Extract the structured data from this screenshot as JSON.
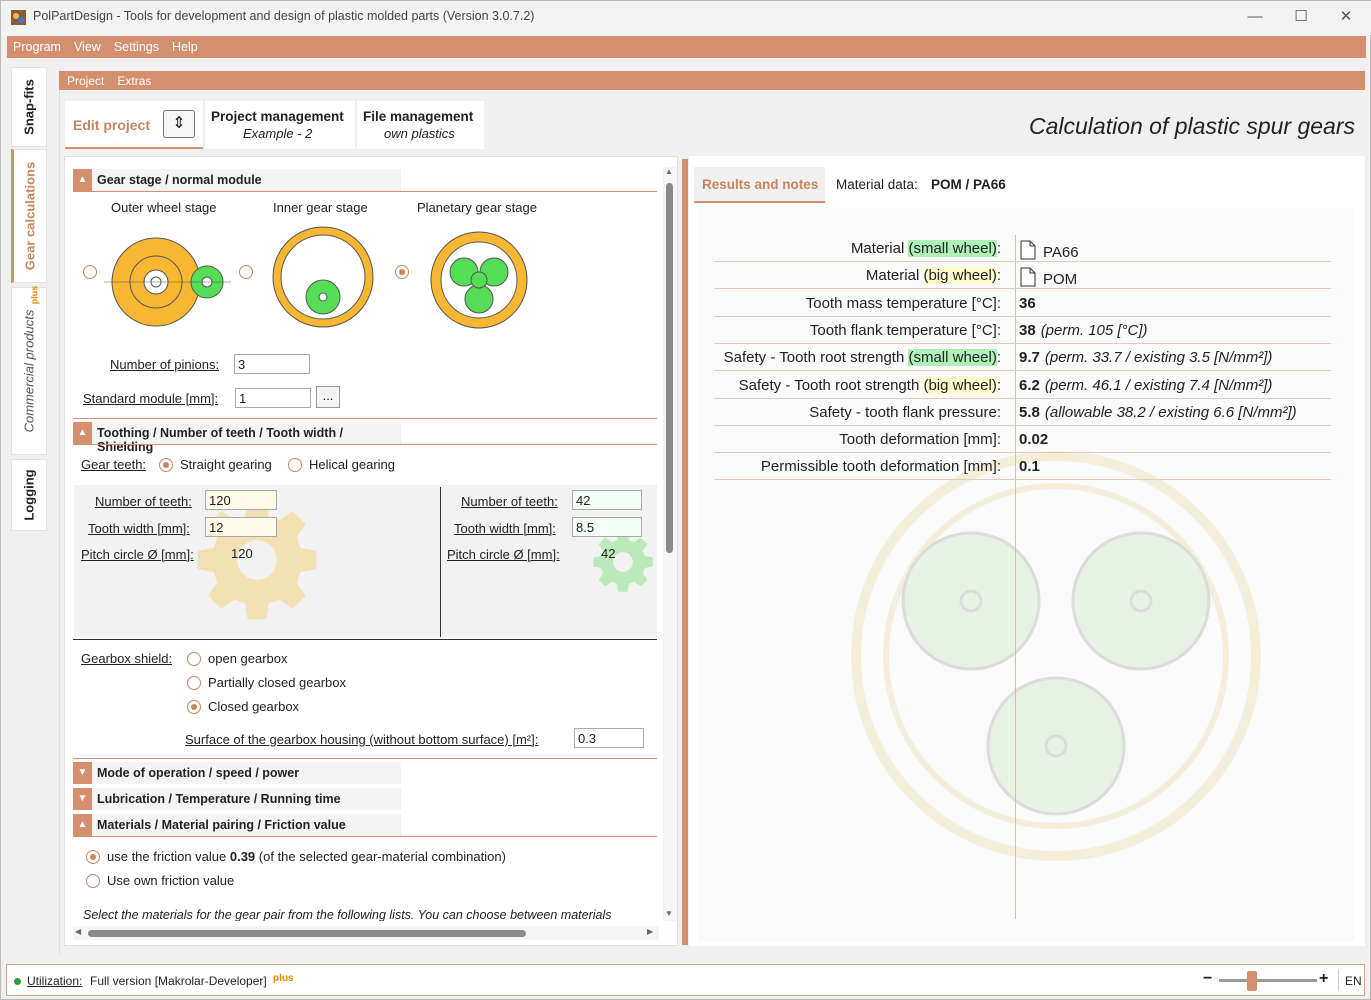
{
  "app": {
    "title": "PolPartDesign - Tools for development and design of plastic molded parts (Version 3.0.7.2)",
    "window_controls": {
      "minimize": "—",
      "maximize": "☐",
      "close": "✕"
    }
  },
  "menu": [
    "Program",
    "View",
    "Settings",
    "Help"
  ],
  "side_tabs": {
    "snapfits": "Snap-fits",
    "gear": "Gear calculations",
    "commercial": "Commercial products",
    "plus": "plus",
    "logging": "Logging"
  },
  "submenu": [
    "Project",
    "Extras"
  ],
  "project_tabs": {
    "edit": "Edit project",
    "pm_title": "Project management",
    "pm_sub": "Example - 2",
    "fm_title": "File management",
    "fm_sub": "own plastics"
  },
  "page_title": "Calculation of plastic spur gears",
  "gear_stage": {
    "header": "Gear stage / normal module",
    "options": [
      "Outer wheel stage",
      "Inner gear stage",
      "Planetary gear stage"
    ],
    "selected": 2,
    "pinions_label": "Number of pinions:",
    "pinions_value": "3",
    "module_label": "Standard module [mm]:",
    "module_value": "1",
    "browse": "..."
  },
  "toothing": {
    "header": "Toothing / Number of teeth / Tooth width / Shielding",
    "gear_teeth_label": "Gear teeth:",
    "straight": "Straight gearing",
    "helical": "Helical gearing",
    "teeth_label": "Number of teeth:",
    "width_label": "Tooth width [mm]:",
    "pitch_label": "Pitch circle Ø [mm]:",
    "left": {
      "teeth": "120",
      "width": "12",
      "pitch": "120"
    },
    "right": {
      "teeth": "42",
      "width": "8.5",
      "pitch": "42"
    },
    "shield_label": "Gearbox shield:",
    "shield_options": [
      "open gearbox",
      "Partially closed gearbox",
      "Closed gearbox"
    ],
    "shield_selected": 2,
    "surface_label": "Surface of the gearbox housing (without bottom surface) [m²]:",
    "surface_value": "0.3"
  },
  "collapsed_sections": [
    "Mode of operation / speed / power",
    "Lubrication / Temperature / Running time"
  ],
  "materials": {
    "header": "Materials / Material pairing / Friction value",
    "opt1_pre": "use the friction value ",
    "opt1_val": "0.39",
    "opt1_post": " (of the selected gear-material combination)",
    "opt2": "Use own friction value",
    "note": "Select the materials for the gear pair from the following lists. You can choose between materials"
  },
  "results_tabs": {
    "results": "Results and notes",
    "material_label": "Material data:",
    "material_value": "POM / PA66"
  },
  "results": [
    {
      "pre": "Material ",
      "hl": "(small wheel)",
      "hlc": "g",
      "post": ":",
      "value": "PA66",
      "file": true,
      "extra": ""
    },
    {
      "pre": "Material ",
      "hl": "(big wheel)",
      "hlc": "y",
      "post": ":",
      "value": "POM",
      "file": true,
      "extra": ""
    },
    {
      "pre": "Tooth mass temperature [°C]:",
      "hl": "",
      "hlc": "",
      "post": "",
      "value": "36",
      "file": false,
      "extra": ""
    },
    {
      "pre": "Tooth flank temperature [°C]:",
      "hl": "",
      "hlc": "",
      "post": "",
      "value": "38",
      "file": false,
      "extra": "(perm. 105 [°C])"
    },
    {
      "pre": "Safety - Tooth root strength ",
      "hl": "(small wheel)",
      "hlc": "g",
      "post": ":",
      "value": "9.7",
      "file": false,
      "extra": "(perm. 33.7 / existing 3.5 [N/mm²])"
    },
    {
      "pre": "Safety - Tooth root strength ",
      "hl": "(big wheel)",
      "hlc": "y",
      "post": ":",
      "value": "6.2",
      "file": false,
      "extra": "(perm. 46.1 / existing 7.4 [N/mm²])"
    },
    {
      "pre": "Safety - tooth flank pressure:",
      "hl": "",
      "hlc": "",
      "post": "",
      "value": "5.8",
      "file": false,
      "extra": "(allowable 38.2 / existing 6.6 [N/mm²])"
    },
    {
      "pre": "Tooth deformation [mm]:",
      "hl": "",
      "hlc": "",
      "post": "",
      "value": "0.02",
      "file": false,
      "extra": ""
    },
    {
      "pre": "Permissible tooth deformation [mm]:",
      "hl": "",
      "hlc": "",
      "post": "",
      "value": "0.1",
      "file": false,
      "extra": ""
    }
  ],
  "status": {
    "label": "Utilization:",
    "value": "Full version [Makrolar-Developer]",
    "plus": "plus",
    "lang": "EN",
    "zoom_minus": "−",
    "zoom_plus": "+"
  }
}
